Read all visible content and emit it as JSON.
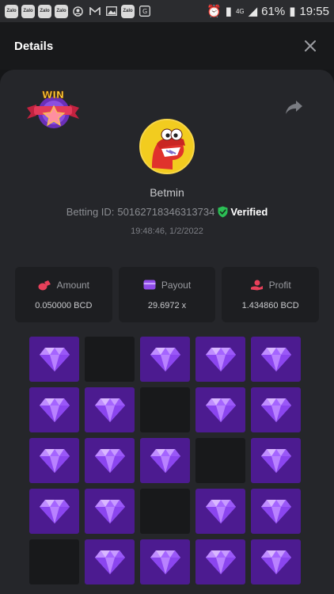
{
  "status_bar": {
    "left_icons": [
      {
        "type": "chip",
        "label": "Zalo"
      },
      {
        "type": "chip",
        "label": "Zalo"
      },
      {
        "type": "chip",
        "label": "Zalo"
      },
      {
        "type": "chip",
        "label": "Zalo"
      },
      {
        "type": "glyph",
        "icon": "account-circle-icon"
      },
      {
        "type": "glyph",
        "icon": "gmail-icon"
      },
      {
        "type": "glyph",
        "icon": "gallery-icon"
      },
      {
        "type": "chip",
        "label": "Zalo"
      },
      {
        "type": "glyph",
        "icon": "translate-icon"
      }
    ],
    "network": "4G",
    "battery": "61%",
    "time": "19:55"
  },
  "header": {
    "title": "Details"
  },
  "bet": {
    "player_name": "Betmin",
    "betting_id_label": "Betting ID:",
    "betting_id": "50162718346313734",
    "verified_label": "Verified",
    "timestamp": "19:48:46, 1/2/2022",
    "badge_text": "WIN"
  },
  "stats": {
    "amount": {
      "label": "Amount",
      "value": "0.050000 BCD"
    },
    "payout": {
      "label": "Payout",
      "value": "29.6972 x"
    },
    "profit": {
      "label": "Profit",
      "value": "1.434860 BCD"
    }
  },
  "colors": {
    "gem_tile": "#4c1b90",
    "empty_tile": "#18191b",
    "verified": "#2bbf55",
    "amount_icon": "#e8405a",
    "payout_icon": "#8f4be8",
    "profit_icon": "#e8405a"
  },
  "board": {
    "columns": 5,
    "cells": [
      "gem",
      "empty",
      "gem",
      "gem",
      "gem",
      "gem",
      "gem",
      "empty",
      "gem",
      "gem",
      "gem",
      "gem",
      "gem",
      "empty",
      "gem",
      "gem",
      "gem",
      "empty",
      "gem",
      "gem",
      "empty",
      "gem",
      "gem",
      "gem",
      "gem"
    ]
  }
}
